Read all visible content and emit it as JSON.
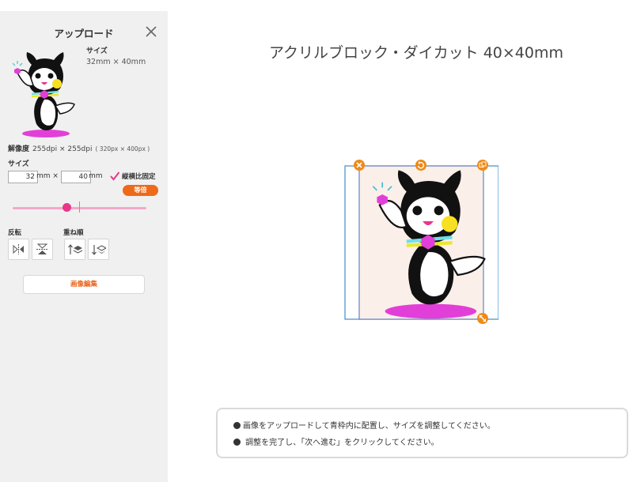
{
  "panel": {
    "title": "アップロード",
    "size_label": "サイズ",
    "size_value": "32mm × 40mm",
    "resolution_label": "解像度",
    "resolution_value": "255dpi × 255dpi",
    "resolution_px": "( 320px × 400px )",
    "size_input_label": "サイズ",
    "width_value": "32",
    "height_value": "40",
    "unit_width": "mm ×",
    "unit_height": "mm",
    "aspect_label": "縦横比固定",
    "aspect_checked": true,
    "equal_button": "等倍",
    "scale_slider": 0.4,
    "flip_label": "反転",
    "order_label": "重ね順",
    "edit_button": "画像編集"
  },
  "main": {
    "title": "アクリルブロック・ダイカット 40×40mm"
  },
  "instructions": [
    "画像をアップロードして青枠内に配置し、サイズを調整してください。",
    " 調整を完了し、「次へ進む」をクリックしてください。"
  ],
  "colors": {
    "accent_orange": "#ee6a18",
    "accent_pink": "#e8368a",
    "frame_blue": "#3f8ecf"
  }
}
